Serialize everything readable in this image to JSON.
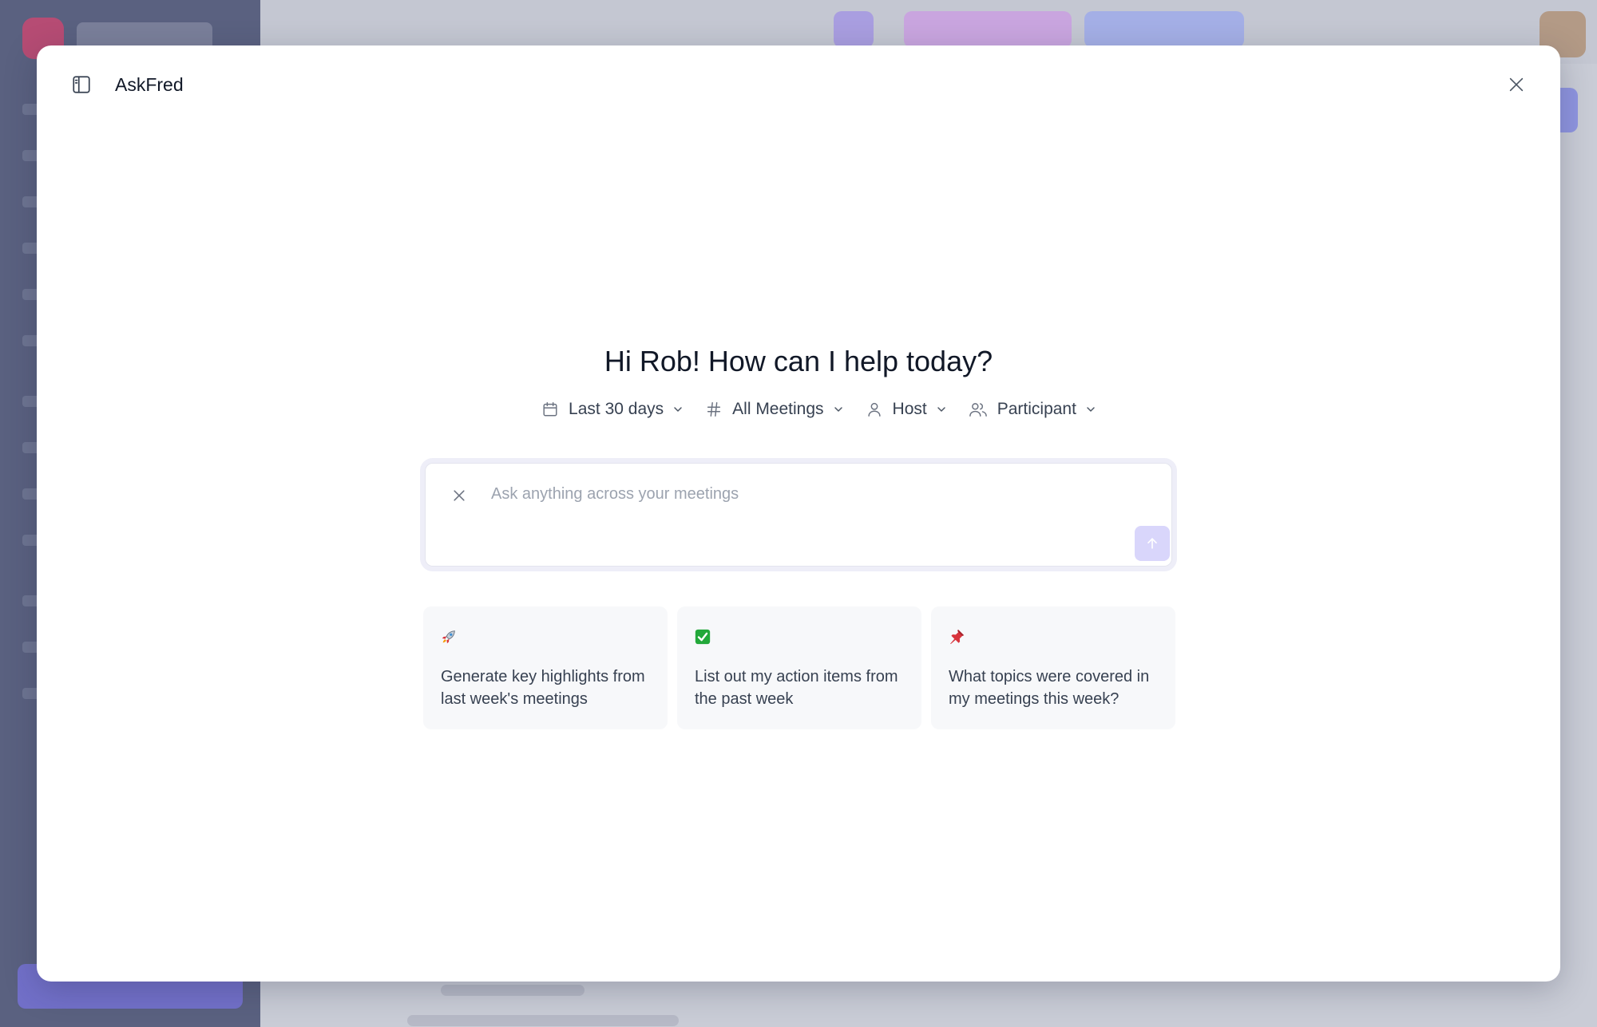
{
  "modal": {
    "title": "AskFred",
    "greeting": "Hi Rob! How can I help today?"
  },
  "filters": [
    {
      "label": "Last 30 days",
      "icon": "calendar-icon"
    },
    {
      "label": "All Meetings",
      "icon": "hash-icon"
    },
    {
      "label": "Host",
      "icon": "user-icon"
    },
    {
      "label": "Participant",
      "icon": "users-icon"
    }
  ],
  "prompt": {
    "placeholder": "Ask anything across your meetings",
    "value": ""
  },
  "suggestions": [
    {
      "icon": "rocket-icon",
      "text": "Generate key highlights from last week's meetings"
    },
    {
      "icon": "check-mark-icon",
      "text": "List out my action items from the past week"
    },
    {
      "icon": "pushpin-icon",
      "text": "What topics were covered in my meetings this week?"
    }
  ],
  "colors": {
    "accent": "#d9d6fb",
    "check_green": "#22a83a",
    "pin_red": "#d8343c"
  }
}
